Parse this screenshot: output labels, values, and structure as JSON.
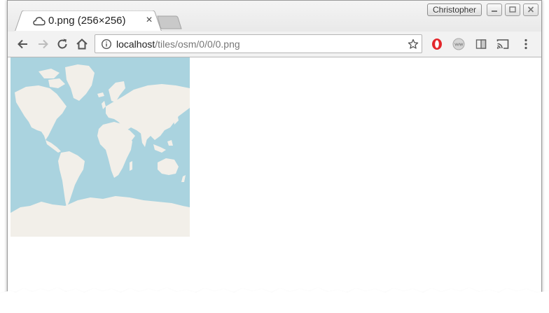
{
  "tab": {
    "title": "0.png (256×256)",
    "close_glyph": "×",
    "icon": "cloud-icon"
  },
  "window": {
    "profile_name": "Christopher",
    "buttons": [
      "minimize-icon",
      "restore-icon",
      "close-icon"
    ]
  },
  "toolbar": {
    "back_icon": "arrow-left-icon",
    "forward_icon": "arrow-right-icon",
    "reload_icon": "reload-icon",
    "home_icon": "home-icon",
    "extensions": [
      "opera-icon",
      "www-icon",
      "reader-icon",
      "cast-icon"
    ],
    "menu_icon": "kebab-menu-icon"
  },
  "omnibox": {
    "host": "localhost",
    "path": "/tiles/osm/0/0/0.png",
    "info_icon": "info-icon",
    "bookmark_icon": "star-icon"
  },
  "content": {
    "image_desc": "world-map-tile",
    "colors": {
      "water": "#aad3df",
      "land": "#f2efe9"
    }
  }
}
